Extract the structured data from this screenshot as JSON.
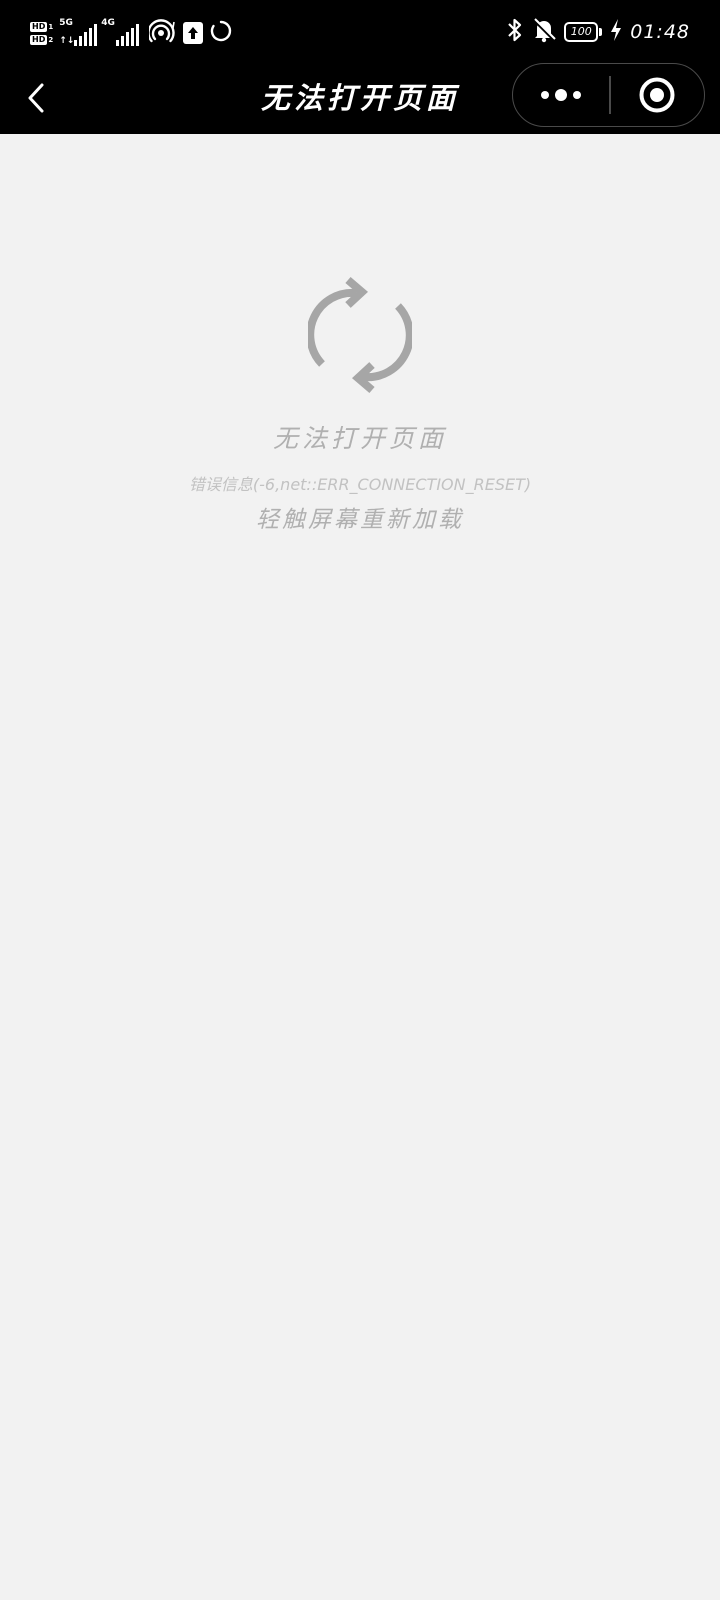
{
  "status_bar": {
    "hd1": "HD",
    "hd1_num": "1",
    "hd2": "HD",
    "hd2_num": "2",
    "network1": "5G",
    "network1_arrows": "↑↓",
    "network2": "4G",
    "battery_level": "100",
    "time": "01:48",
    "icons": [
      "hotspot-icon",
      "upload-icon",
      "loading-circle-icon",
      "bluetooth-icon",
      "bell-off-icon",
      "charging-icon"
    ]
  },
  "nav": {
    "title": "无法打开页面",
    "icons": [
      "back-arrow-icon",
      "more-dots-icon",
      "close-target-icon"
    ]
  },
  "error": {
    "icon": "refresh-icon",
    "title": "无法打开页面",
    "detail": "错误信息(-6,net::ERR_CONNECTION_RESET)",
    "hint": "轻触屏幕重新加载"
  },
  "colors": {
    "bar_bg": "#000000",
    "page_bg": "#f2f2f2",
    "icon_gray": "#a6a6a6",
    "text_gray": "#b0b0b0"
  }
}
